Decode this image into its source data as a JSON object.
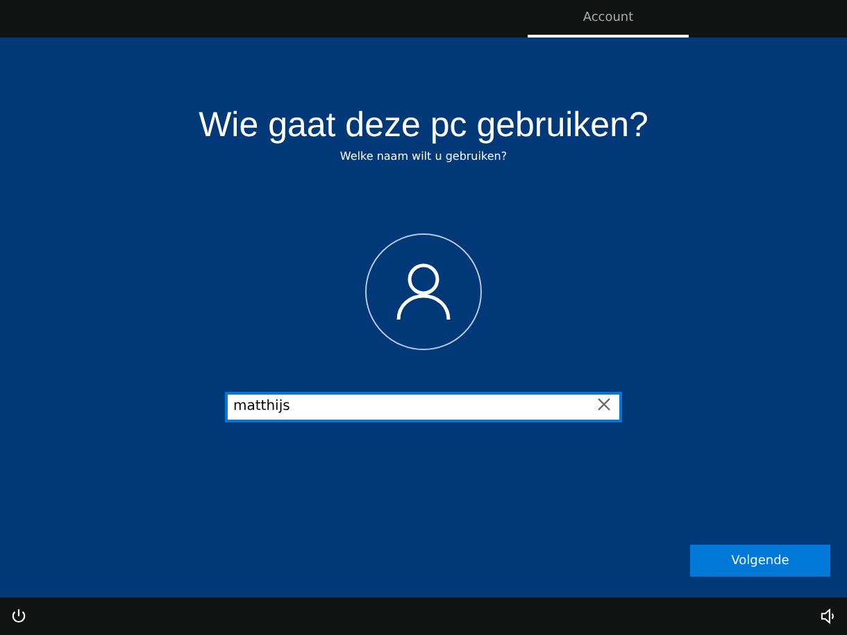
{
  "tabs": [
    {
      "label": "Account",
      "selected": true
    }
  ],
  "title": "Wie gaat deze pc gebruiken?",
  "subtitle": "Welke naam wilt u gebruiken?",
  "name_field": {
    "value": "matthijs",
    "focused": true
  },
  "next_button": "Volgende"
}
